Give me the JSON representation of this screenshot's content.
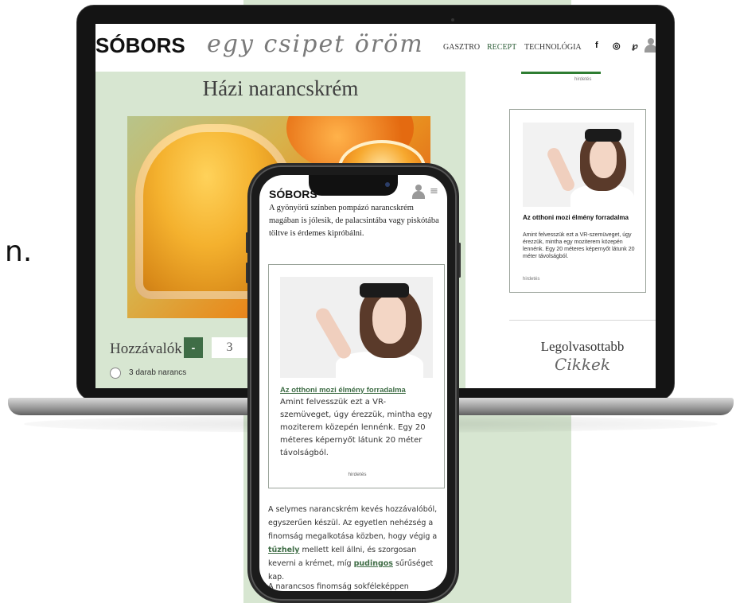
{
  "side_char": "n.",
  "site": {
    "logo": "SÓBORS",
    "tagline": "egy csipet öröm",
    "nav": [
      "GASZTRO",
      "RECEPT",
      "TECHNOLÓGIA"
    ],
    "social": [
      "f",
      "◎",
      "℘"
    ]
  },
  "article": {
    "title": "Házi narancskrém",
    "ingredients_title": "Hozzávalók",
    "minus_label": "-",
    "quantity": "3",
    "ingredient_1": "3 darab narancs"
  },
  "sidebar": {
    "ad_label_top": "hirdetés",
    "ad": {
      "title": "Az otthoni mozi élmény forradalma",
      "text": "Amint felvesszük ezt a VR-szemüveget, úgy érezzük, mintha egy moziterem közepén lennénk. Egy 20 méteres képernyőt látunk 20 méter távolságból.",
      "label": "hirdetés"
    },
    "popular_title": "Legolvasottabb",
    "popular_sub": "Cikkek"
  },
  "phone": {
    "logo": "SÓBORS",
    "menu_icon": "≡",
    "intro": "A gyönyörű színben pompázó narancskrém magában is jólesik, de palacsintába vagy piskótába töltve is érdemes kipróbálni.",
    "ad": {
      "title": "Az otthoni mozi élmény forradalma",
      "text": "Amint felvesszük ezt a VR-szemüveget, úgy érezzük, mintha egy moziterem közepén lennénk. Egy 20 méteres képernyőt látunk 20 méter távolságból.",
      "label": "hirdetés"
    },
    "body_part1": "A selymes narancskrém kevés hozzávalóból, egyszerűen készül. Az egyetlen nehézség a finomság megalkotása közben, hogy végig a ",
    "link1": "tűzhely",
    "body_part2": " mellett kell állni, és szorgosan keverni a krémet, míg ",
    "link2": "pudingos",
    "body_part3": " sűrűséget kap.",
    "last_line": "A narancsos finomság sokféleképpen"
  },
  "colors": {
    "mint_background": "#d7e6d1",
    "brand_green": "#3f6d46",
    "phone_frame": "#1b1b1b"
  }
}
